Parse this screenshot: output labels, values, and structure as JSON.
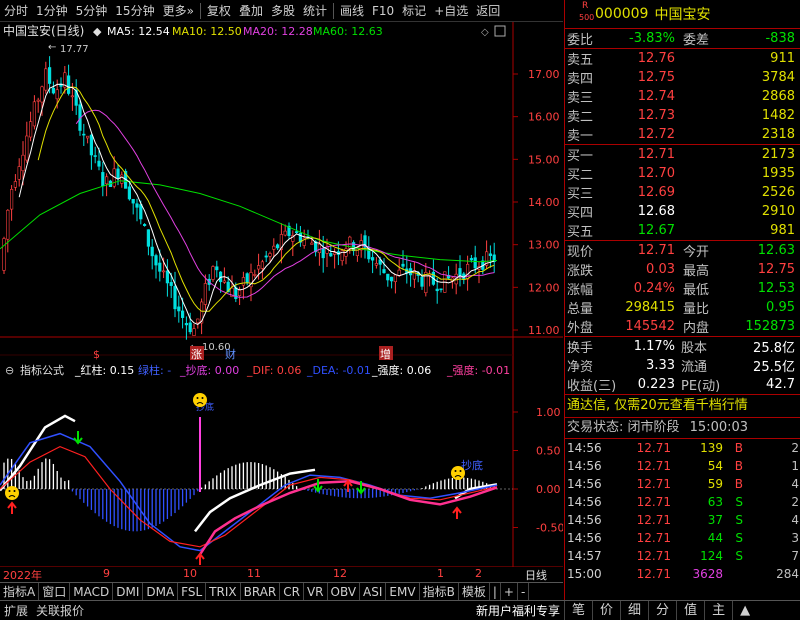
{
  "toolbar": {
    "items": [
      "分时",
      "1分钟",
      "5分钟",
      "15分钟",
      "更多»",
      "复权",
      "叠加",
      "多股",
      "统计",
      "画线",
      "F10",
      "标记",
      "+自选",
      "返回"
    ]
  },
  "main_chart": {
    "title": "中国宝安(日线)",
    "indicator_dot": "◆",
    "ma5": "MA5: 12.54",
    "ma10": "MA10: 12.50",
    "ma20": "MA20: 12.28",
    "ma60": "MA60: 12.63",
    "high_label": "17.77",
    "low_label": "10.60",
    "marker_s": "$",
    "marker_zhang": "涨",
    "marker_cai": "财",
    "marker_zeng": "增",
    "y_ticks": [
      "17.00",
      "16.00",
      "15.00",
      "14.00",
      "13.00",
      "12.00",
      "11.00"
    ]
  },
  "sub_chart": {
    "name": "指标公式",
    "hongzhu": "_红柱: 0.15",
    "lvzhu": "绿柱: -",
    "chaodi": "_抄底: 0.00",
    "dif": "_DIF: 0.06",
    "dea": "_DEA: -0.01",
    "qiangdu1": "_强度: 0.06",
    "qiangdu2": "_强度: -0.01",
    "label_chaodi_small": "抄底",
    "label_chaodi": "抄底",
    "y_ticks": [
      "1.00",
      "0.50",
      "0.00",
      "-0.50"
    ]
  },
  "x_axis": {
    "labels": [
      "2022年",
      "9",
      "10",
      "11",
      "12",
      "1",
      "2"
    ],
    "right_label": "日线"
  },
  "bottom_tabs": [
    "指标A",
    "窗口",
    "MACD",
    "DMI",
    "DMA",
    "FSL",
    "TRIX",
    "BRAR",
    "CR",
    "VR",
    "OBV",
    "ASI",
    "EMV",
    "指标B",
    "模板",
    "|",
    "+",
    "-"
  ],
  "status_bar": {
    "left": [
      "扩展",
      "关联报价"
    ],
    "promo": "新用户福利专享",
    "right_tabs": [
      "笔",
      "价",
      "细",
      "分",
      "值",
      "主",
      "▲"
    ]
  },
  "quote": {
    "code_prefix": "R",
    "code_sub": "500",
    "code": "000009",
    "name": "中国宝安",
    "weibi_label": "委比",
    "weibi": "-3.83%",
    "weicha_label": "委差",
    "weicha": "-838",
    "asks": [
      {
        "label": "卖五",
        "price": "12.76",
        "vol": "911"
      },
      {
        "label": "卖四",
        "price": "12.75",
        "vol": "3784"
      },
      {
        "label": "卖三",
        "price": "12.74",
        "vol": "2868"
      },
      {
        "label": "卖二",
        "price": "12.73",
        "vol": "1482"
      },
      {
        "label": "卖一",
        "price": "12.72",
        "vol": "2318"
      }
    ],
    "bids": [
      {
        "label": "买一",
        "price": "12.71",
        "vol": "2173",
        "pc": "red"
      },
      {
        "label": "买二",
        "price": "12.70",
        "vol": "1935",
        "pc": "red"
      },
      {
        "label": "买三",
        "price": "12.69",
        "vol": "2526",
        "pc": "red"
      },
      {
        "label": "买四",
        "price": "12.68",
        "vol": "2910",
        "pc": "white"
      },
      {
        "label": "买五",
        "price": "12.67",
        "vol": "981",
        "pc": "green"
      }
    ],
    "stats": [
      {
        "l1": "现价",
        "v1": "12.71",
        "c1": "red",
        "l2": "今开",
        "v2": "12.63",
        "c2": "green"
      },
      {
        "l1": "涨跌",
        "v1": "0.03",
        "c1": "red",
        "l2": "最高",
        "v2": "12.75",
        "c2": "red"
      },
      {
        "l1": "涨幅",
        "v1": "0.24%",
        "c1": "red",
        "l2": "最低",
        "v2": "12.53",
        "c2": "green"
      },
      {
        "l1": "总量",
        "v1": "298415",
        "c1": "yellow",
        "l2": "量比",
        "v2": "0.95",
        "c2": "green"
      },
      {
        "l1": "外盘",
        "v1": "145542",
        "c1": "red",
        "l2": "内盘",
        "v2": "152873",
        "c2": "green"
      }
    ],
    "stats2": [
      {
        "l1": "换手",
        "v1": "1.17%",
        "l2": "股本",
        "v2": "25.8亿"
      },
      {
        "l1": "净资",
        "v1": "3.33",
        "l2": "流通",
        "v2": "25.5亿"
      },
      {
        "l1": "收益(三)",
        "v1": "0.223",
        "l2": "PE(动)",
        "v2": "42.7"
      }
    ],
    "promo": "通达信, 仅需20元查看千档行情",
    "trade_status_label": "交易状态: 闭市阶段",
    "trade_status_time": "15:00:03",
    "ticks": [
      {
        "t": "14:56",
        "p": "12.71",
        "v": "139",
        "vc": "yellow",
        "bs": "B",
        "bsc": "red",
        "x": "2"
      },
      {
        "t": "14:56",
        "p": "12.71",
        "v": "54",
        "vc": "yellow",
        "bs": "B",
        "bsc": "red",
        "x": "1"
      },
      {
        "t": "14:56",
        "p": "12.71",
        "v": "59",
        "vc": "yellow",
        "bs": "B",
        "bsc": "red",
        "x": "4"
      },
      {
        "t": "14:56",
        "p": "12.71",
        "v": "63",
        "vc": "green",
        "bs": "S",
        "bsc": "green",
        "x": "2"
      },
      {
        "t": "14:56",
        "p": "12.71",
        "v": "37",
        "vc": "green",
        "bs": "S",
        "bsc": "green",
        "x": "4"
      },
      {
        "t": "14:56",
        "p": "12.71",
        "v": "44",
        "vc": "green",
        "bs": "S",
        "bsc": "green",
        "x": "3"
      },
      {
        "t": "14:57",
        "p": "12.71",
        "v": "124",
        "vc": "green",
        "bs": "S",
        "bsc": "green",
        "x": "7"
      },
      {
        "t": "15:00",
        "p": "12.71",
        "v": "3628",
        "vc": "magenta",
        "bs": "",
        "bsc": "",
        "x": "284"
      }
    ]
  },
  "colors": {
    "up": "#ff4040",
    "down": "#00e0e0",
    "ma5": "#ffffff",
    "ma10": "#e0e000",
    "ma20": "#e040e0",
    "ma60": "#00e000",
    "border": "#aa0000"
  }
}
